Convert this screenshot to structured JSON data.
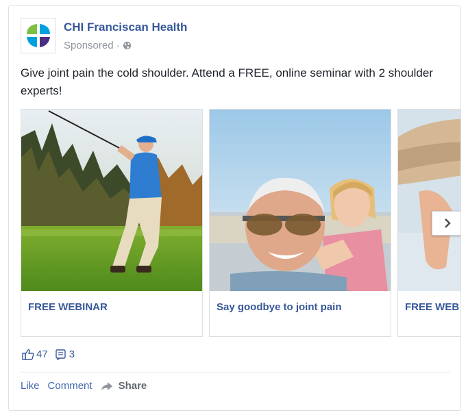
{
  "post": {
    "page_name": "CHI Franciscan Health",
    "sponsored_label": "Sponsored",
    "separator": "·",
    "text": "Give joint pain the cold shoulder. Attend a FREE, online seminar with 2 shoulder experts!"
  },
  "carousel": {
    "cards": [
      {
        "caption": "FREE WEBINAR",
        "image": "golfer-swinging-photo"
      },
      {
        "caption": "Say goodbye to joint pain",
        "image": "grandfather-granddaughter-photo"
      },
      {
        "caption": "FREE WEB",
        "image": "paddleboard-photo"
      }
    ],
    "next_icon": "chevron-right-icon"
  },
  "stats": {
    "likes": "47",
    "comments": "3"
  },
  "actions": {
    "like": "Like",
    "comment": "Comment",
    "share": "Share"
  },
  "colors": {
    "link": "#365899",
    "action": "#4267b2",
    "muted": "#90949c",
    "text": "#1d2129",
    "border": "#dddfe2"
  }
}
